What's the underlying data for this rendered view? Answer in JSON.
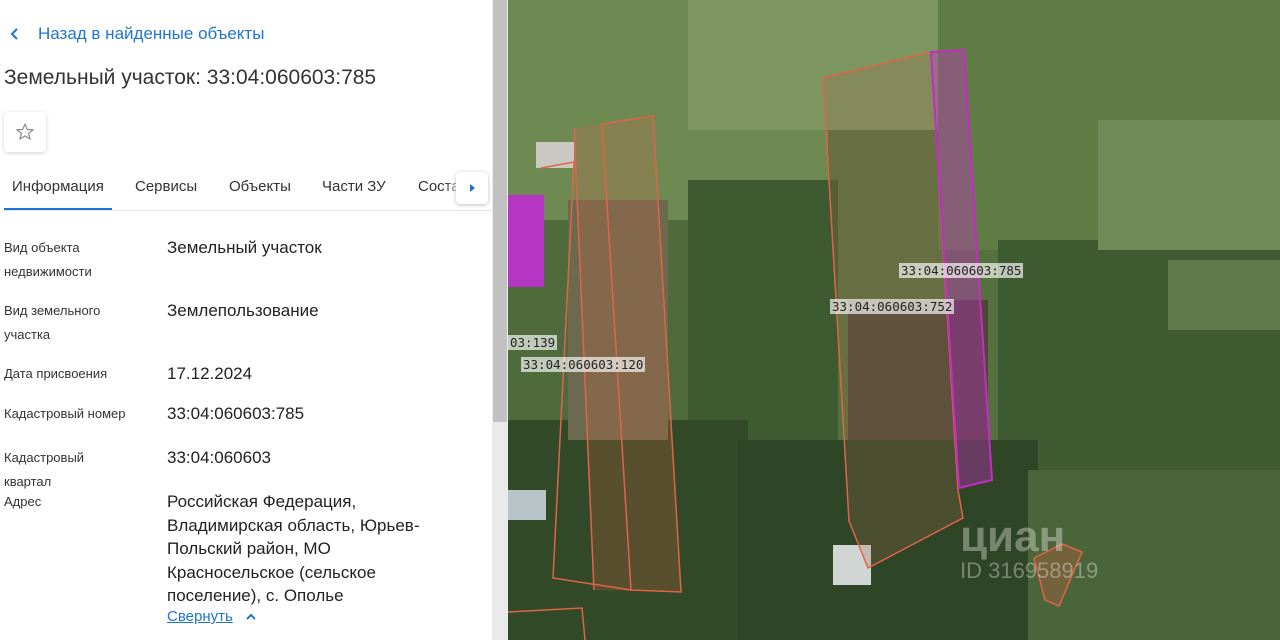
{
  "header": {
    "back_label": "Назад в найденные объекты",
    "title": "Земельный участок: 33:04:060603:785"
  },
  "tabs": [
    {
      "label": "Информация",
      "active": true
    },
    {
      "label": "Сервисы",
      "active": false
    },
    {
      "label": "Объекты",
      "active": false
    },
    {
      "label": "Части ЗУ",
      "active": false
    },
    {
      "label": "Соста",
      "active": false
    }
  ],
  "details": {
    "rows": [
      {
        "label": "Вид объекта недвижимости",
        "value": "Земельный участок"
      },
      {
        "label": "Вид земельного участка",
        "value": "Землепользование"
      },
      {
        "label": "Дата присвоения",
        "value": "17.12.2024"
      },
      {
        "label": "Кадастровый номер",
        "value": "33:04:060603:785"
      },
      {
        "label": "Кадастровый квартал",
        "value": "33:04:060603"
      },
      {
        "label": "Адрес",
        "value": "Российская Федерация, Владимирская область, Юрьев-Польский район, МО Красносельское (сельское поселение), с. Ополье"
      }
    ],
    "collapse_label": "Свернуть"
  },
  "map": {
    "parcel_labels": [
      "33:04:060603:785",
      "33:04:060603:752",
      "33:04:060603:120",
      "03:139"
    ],
    "watermark": "циан",
    "watermark_id": "ID 316958919",
    "colors": {
      "selected_outline": "#c42dc4",
      "parcel_outline": "#e0644a",
      "accent": "#1f74d1"
    }
  }
}
